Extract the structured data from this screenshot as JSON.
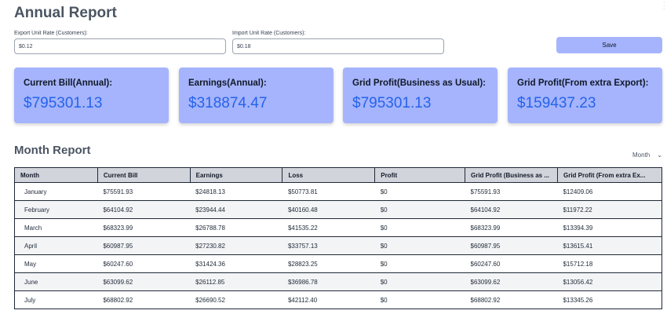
{
  "annual": {
    "title": "Annual Report",
    "export_label": "Export Unit Rate (Customers):",
    "export_value": "$0.12",
    "import_label": "Import Unit Rate (Customers):",
    "import_value": "$0.18",
    "save_label": "Save"
  },
  "cards": [
    {
      "label": "Current Bill(Annual):",
      "value": "$795301.13"
    },
    {
      "label": "Earnings(Annual):",
      "value": "$318874.47"
    },
    {
      "label": "Grid Profit(Business as Usual):",
      "value": "$795301.13"
    },
    {
      "label": "Grid Profit(From extra Export):",
      "value": "$159437.23"
    }
  ],
  "month_report": {
    "title": "Month Report",
    "select_value": "Month",
    "columns": [
      "Month",
      "Current Bill",
      "Earnings",
      "Loss",
      "Profit",
      "Grid Profit (Business as ...",
      "Grid Profit (From extra Ex..."
    ],
    "rows": [
      [
        "January",
        "$75591.93",
        "$24818.13",
        "$50773.81",
        "$0",
        "$75591.93",
        "$12409.06"
      ],
      [
        "February",
        "$64104.92",
        "$23944.44",
        "$40160.48",
        "$0",
        "$64104.92",
        "$11972.22"
      ],
      [
        "March",
        "$68323.99",
        "$26788.78",
        "$41535.22",
        "$0",
        "$68323.99",
        "$13394.39"
      ],
      [
        "April",
        "$60987.95",
        "$27230.82",
        "$33757.13",
        "$0",
        "$60987.95",
        "$13615.41"
      ],
      [
        "May",
        "$60247.60",
        "$31424.36",
        "$28823.25",
        "$0",
        "$60247.60",
        "$15712.18"
      ],
      [
        "June",
        "$63099.62",
        "$26112.85",
        "$36986.78",
        "$0",
        "$63099.62",
        "$13056.42"
      ],
      [
        "July",
        "$68802.92",
        "$26690.52",
        "$42112.40",
        "$0",
        "$68802.92",
        "$13345.26"
      ]
    ]
  },
  "colors": {
    "card_bg": "#a5b4fc",
    "card_value": "#2563eb",
    "save_bg": "#a5b4fc",
    "table_header_bg": "#d1d5db"
  },
  "icons": {
    "select_chevron": "chevron-down-icon",
    "scroll_handle": "vertical-dots-icon"
  }
}
